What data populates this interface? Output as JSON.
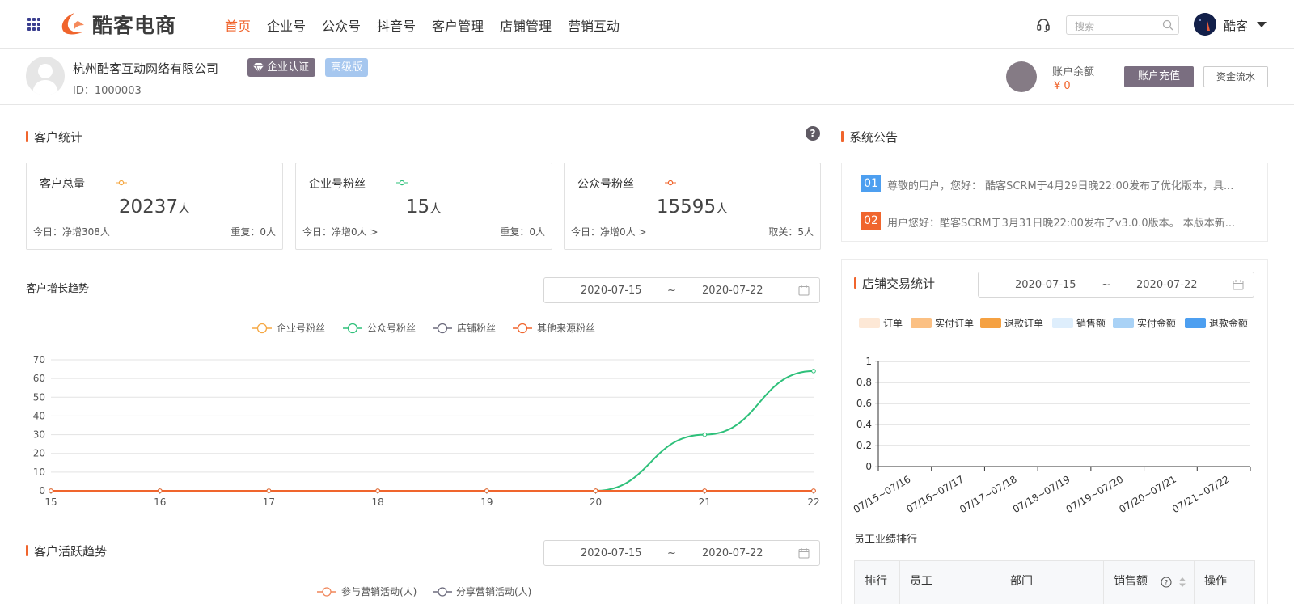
{
  "header": {
    "logo_text": "酷客电商",
    "nav": [
      {
        "label": "首页",
        "active": true
      },
      {
        "label": "企业号",
        "active": false
      },
      {
        "label": "公众号",
        "active": false
      },
      {
        "label": "抖音号",
        "active": false
      },
      {
        "label": "客户管理",
        "active": false
      },
      {
        "label": "店铺管理",
        "active": false
      },
      {
        "label": "营销互动",
        "active": false
      }
    ],
    "search_placeholder": "搜索",
    "user_name": "酷客"
  },
  "company": {
    "name": "杭州酷客互动网络有限公司",
    "id_text": "ID：1000003",
    "cert_badge": "企业认证",
    "version_badge": "高级版",
    "balance_label": "账户余额",
    "balance_value": "¥ 0",
    "recharge_button": "账户充值",
    "flow_button": "资金流水"
  },
  "customer_stats": {
    "title": "客户统计",
    "help": "?",
    "cards": [
      {
        "label": "客户总量",
        "value": "20237",
        "unit": "人",
        "left": "今日：净增308人",
        "right": "重复：0人",
        "dot_color": "#f5a742"
      },
      {
        "label": "企业号粉丝",
        "value": "15",
        "unit": "人",
        "left": "今日：净增0人 >",
        "right": "重复：0人",
        "dot_color": "#2ec07a"
      },
      {
        "label": "公众号粉丝",
        "value": "15595",
        "unit": "人",
        "left": "今日：净增0人 >",
        "right": "取关：5人",
        "dot_color": "#f0652d"
      }
    ]
  },
  "growth_trend": {
    "title": "客户增长趋势",
    "date_start": "2020-07-15",
    "date_sep": "~",
    "date_end": "2020-07-22"
  },
  "active_trend": {
    "title": "客户活跃趋势",
    "date_start": "2020-07-15",
    "date_sep": "~",
    "date_end": "2020-07-22",
    "legend": [
      {
        "name": "参与营销活动(人)",
        "color": "#f0865a"
      },
      {
        "name": "分享营销活动(人)",
        "color": "#6b6a7c"
      }
    ]
  },
  "notices": {
    "title": "系统公告",
    "items": [
      {
        "num": "01",
        "color": "#4d9ff0",
        "text": "尊敬的用户，您好： 酷客SCRM于4月29日晚22:00发布了优化版本，具..."
      },
      {
        "num": "02",
        "color": "#f0652d",
        "text": "用户您好：酷客SCRM于3月31日晚22:00发布了v3.0.0版本。 本版本新..."
      }
    ]
  },
  "store_stats": {
    "title": "店铺交易统计",
    "date_start": "2020-07-15",
    "date_sep": "~",
    "date_end": "2020-07-22",
    "legend": [
      {
        "name": "订单",
        "color": "#fde8d6"
      },
      {
        "name": "实付订单",
        "color": "#fbc083"
      },
      {
        "name": "退款订单",
        "color": "#f5a142"
      },
      {
        "name": "销售额",
        "color": "#deeefc"
      },
      {
        "name": "实付金额",
        "color": "#a9d2f6"
      },
      {
        "name": "退款金额",
        "color": "#4d9ff0"
      }
    ]
  },
  "ranking": {
    "title": "员工业绩排行",
    "columns": [
      "排行",
      "员工",
      "部门",
      "销售额",
      "操作"
    ]
  },
  "chart_data": [
    {
      "type": "line",
      "x": [
        "15",
        "16",
        "17",
        "18",
        "19",
        "20",
        "21",
        "22"
      ],
      "ylim": [
        0,
        70
      ],
      "yticks": [
        "0",
        "10",
        "20",
        "30",
        "40",
        "50",
        "60",
        "70"
      ],
      "grid": true,
      "legend_position": "top-center",
      "series": [
        {
          "name": "企业号粉丝",
          "color": "#f5a742",
          "values": [
            0,
            0,
            0,
            0,
            0,
            0,
            0,
            0
          ]
        },
        {
          "name": "公众号粉丝",
          "color": "#2ec07a",
          "values": [
            0,
            0,
            0,
            0,
            0,
            0,
            30,
            64
          ]
        },
        {
          "name": "店铺粉丝",
          "color": "#6b6a7c",
          "values": [
            0,
            0,
            0,
            0,
            0,
            0,
            0,
            0
          ]
        },
        {
          "name": "其他来源粉丝",
          "color": "#f0652d",
          "values": [
            0,
            0,
            0,
            0,
            0,
            0,
            0,
            0
          ]
        }
      ]
    },
    {
      "type": "bar",
      "categories": [
        "07/15~07/16",
        "07/16~07/17",
        "07/17~07/18",
        "07/18~07/19",
        "07/19~07/20",
        "07/20~07/21",
        "07/21~07/22"
      ],
      "ylim": [
        0,
        1
      ],
      "yticks": [
        "0",
        "0.2",
        "0.4",
        "0.6",
        "0.8",
        "1"
      ],
      "grid": true,
      "legend_position": "top",
      "series": []
    }
  ]
}
